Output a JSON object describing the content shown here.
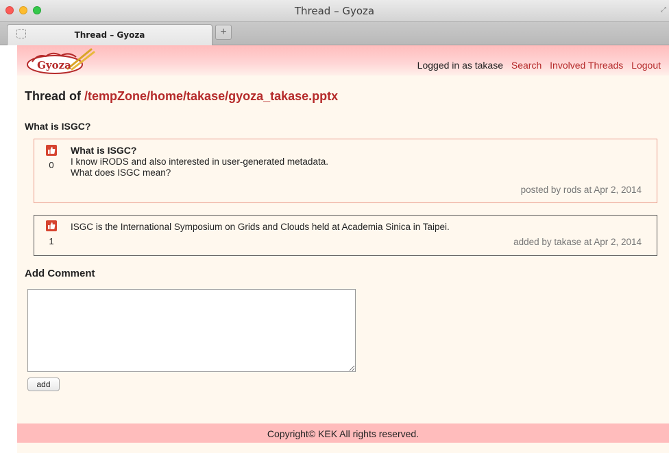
{
  "window": {
    "title": "Thread – Gyoza",
    "tab_label": "Thread – Gyoza",
    "new_tab_label": "+"
  },
  "header": {
    "logo_text": "Gyoza",
    "login_text": "Logged in as takase",
    "nav_links": [
      "Search",
      "Involved Threads",
      "Logout"
    ]
  },
  "thread": {
    "title_prefix": "Thread of",
    "path": "/tempZone/home/takase/gyoza_takase.pptx",
    "subject": "What is ISGC?"
  },
  "posts": [
    {
      "title": "What is ISGC?",
      "body_lines": [
        "I know iRODS and also interested in user-generated metadata.",
        "What does ISGC mean?"
      ],
      "votes": "0",
      "meta": "posted by rods at Apr 2, 2014"
    },
    {
      "body": "ISGC is the International Symposium on Grids and Clouds held at Academia Sinica in Taipei.",
      "votes": "1",
      "meta": "added by takase at Apr 2, 2014"
    }
  ],
  "add_comment": {
    "heading": "Add Comment",
    "placeholder": "",
    "button_label": "add"
  },
  "footer": {
    "text": "Copyright© KEK All rights reserved."
  },
  "colors": {
    "header_pink": "#ffbcbc",
    "link_red": "#b52a2a",
    "page_background": "#fff8ee",
    "thumb_red": "#d64430"
  }
}
